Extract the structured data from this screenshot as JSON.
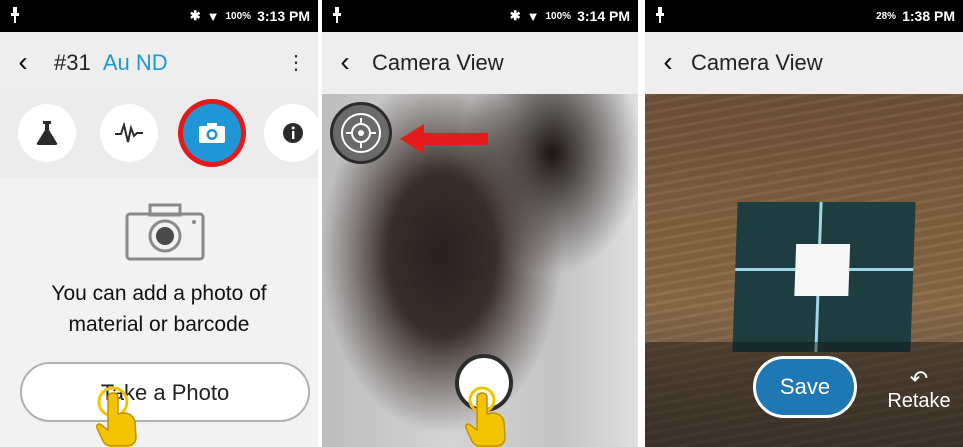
{
  "colors": {
    "accent_blue": "#2196d6",
    "highlight_red": "#e41b1b",
    "save_blue": "#1f78b4",
    "hand_yellow": "#f5c400"
  },
  "panel1": {
    "status": {
      "battery": "100%",
      "time": "3:13 PM"
    },
    "header": {
      "number": "#31",
      "name": "Au ND"
    },
    "tabs": [
      {
        "icon": "flask-icon"
      },
      {
        "icon": "spectrum-icon"
      },
      {
        "icon": "camera-icon",
        "active": true
      },
      {
        "icon": "info-icon"
      }
    ],
    "message_line1": "You can add a photo of",
    "message_line2": "material or barcode",
    "take_photo_label": "Take a Photo"
  },
  "panel2": {
    "status": {
      "battery": "100%",
      "time": "3:14 PM"
    },
    "title": "Camera View"
  },
  "panel3": {
    "status": {
      "battery": "28%",
      "time": "1:38 PM"
    },
    "title": "Camera View",
    "save_label": "Save",
    "retake_label": "Retake"
  }
}
